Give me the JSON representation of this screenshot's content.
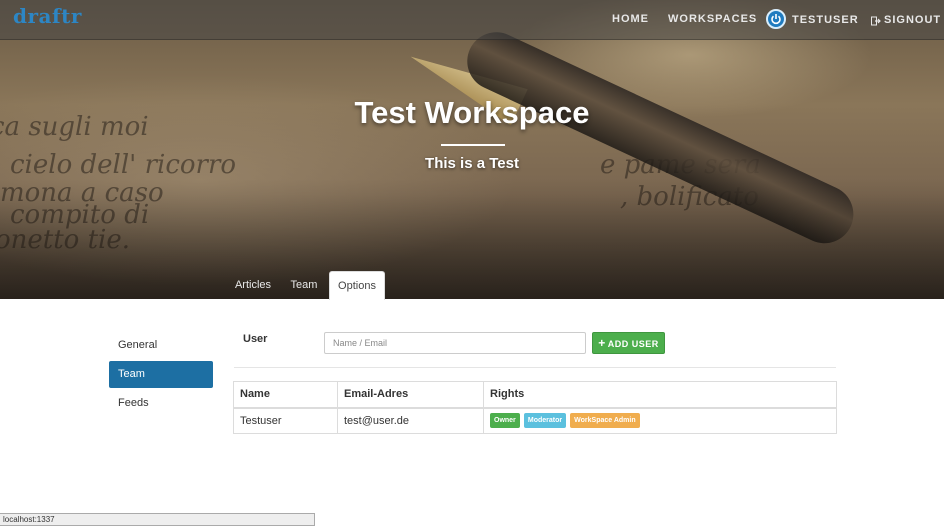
{
  "navbar": {
    "brand": "draftr",
    "links": {
      "home": "HOME",
      "workspaces": "WORKSPACES"
    },
    "user": {
      "name": "TESTUSER",
      "icon": "power-icon"
    },
    "signout": {
      "label": "SIGNOUT",
      "icon": "signout-icon"
    }
  },
  "workspace": {
    "title": "Test Workspace",
    "subtitle": "This is a Test"
  },
  "tabs": [
    {
      "label": "Articles",
      "active": false
    },
    {
      "label": "Team",
      "active": false
    },
    {
      "label": "Options",
      "active": true
    }
  ],
  "sidebar": {
    "items": [
      {
        "label": "General",
        "active": false
      },
      {
        "label": "Team",
        "active": true
      },
      {
        "label": "Feeds",
        "active": false
      }
    ]
  },
  "user_form": {
    "label": "User",
    "placeholder": "Name / Email",
    "value": "",
    "add_button": "ADD USER",
    "add_icon": "plus-icon"
  },
  "team_table": {
    "headers": [
      "Name",
      "Email-Adres",
      "Rights"
    ],
    "rows": [
      {
        "name": "Testuser",
        "email": "test@user.de",
        "rights": [
          {
            "label": "Owner",
            "color": "#4cae4c"
          },
          {
            "label": "Moderator",
            "color": "#5bc0de"
          },
          {
            "label": "WorkSpace Admin",
            "color": "#f0ad4e"
          }
        ]
      }
    ]
  },
  "status_bar": {
    "url": "localhost:1337"
  },
  "colors": {
    "brand": "#2d86c4",
    "sidebar_active": "#1d6fa3",
    "success": "#4cae4c"
  }
}
